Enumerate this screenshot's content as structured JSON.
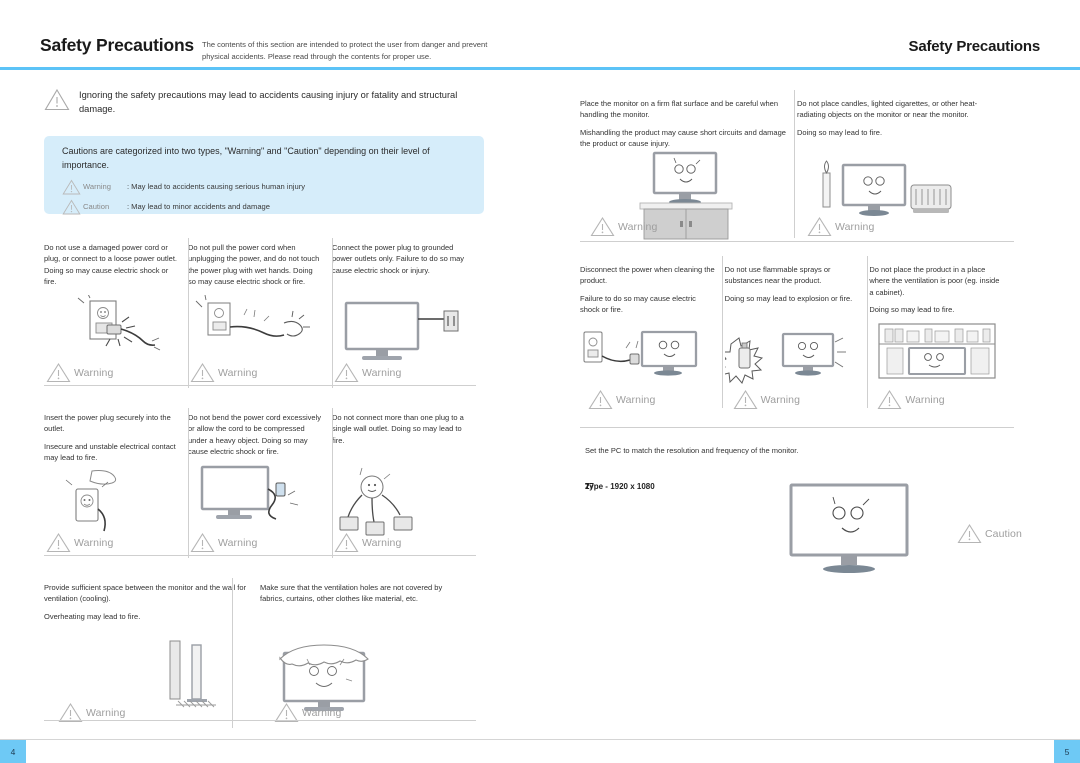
{
  "header": {
    "title_left": "Safety Precautions",
    "subtitle": "The contents of this section are intended to protect the user from danger and prevent physical accidents. Please read through the contents for proper use.",
    "title_right": "Safety Precautions"
  },
  "intro": {
    "icon": "warning-triangle-icon",
    "text": "Ignoring the safety precautions may lead to accidents causing injury or fatality and structural damage."
  },
  "notice": {
    "heading": "Cautions are categorized into two types, \"Warning\" and \"Caution\" depending on their level of importance.",
    "rows": [
      {
        "label": "Warning",
        "separator": ":",
        "desc": "May lead to accidents causing serious human injury"
      },
      {
        "label": "Caution",
        "separator": ":",
        "desc": "May lead to minor accidents and damage"
      }
    ]
  },
  "left_page": {
    "page_number": "4",
    "row1": [
      {
        "text": "Do not use a damaged power cord or plug, or connect to a loose power outlet. Doing so may cause electric shock or fire.",
        "badge": "Warning",
        "art": "outlet-damaged-plug"
      },
      {
        "text": "Do not pull the power cord when unplugging the power, and do not touch the power plug with wet hands. Doing so may cause electric shock or fire.",
        "badge": "Warning",
        "art": "wet-hand-plug"
      },
      {
        "text": "Connect the power plug to grounded power outlets only. Failure to do so may cause electric shock or injury.",
        "badge": "Warning",
        "art": "monitor-grounded"
      }
    ],
    "row2": [
      {
        "text_a": "Insert the power plug securely into the outlet.",
        "text_b": "Insecure and unstable electrical contact may lead to fire.",
        "badge": "Warning",
        "art": "plug-into-outlet"
      },
      {
        "text": "Do not bend the power cord excessively or allow the cord to be compressed under a heavy object. Doing so may cause electric shock or fire.",
        "badge": "Warning",
        "art": "monitor-cord-bend"
      },
      {
        "text": "Do not connect more than one plug to a single wall outlet. Doing so may lead to fire.",
        "badge": "Warning",
        "art": "multi-plug-overload"
      }
    ],
    "row3": [
      {
        "text_a": "Provide sufficient space between the monitor and the wall for ventilation (cooling).",
        "text_b": "Overheating may lead to fire.",
        "badge": "Warning",
        "art": "monitor-wall-gap"
      },
      {
        "text": "Make sure that the ventilation holes are not covered by fabrics, curtains, other clothes like material, etc.",
        "badge": "Warning",
        "art": "monitor-covered-cloth"
      }
    ]
  },
  "right_page": {
    "page_number": "5",
    "row1": [
      {
        "text_a": "Place the monitor on a firm flat surface and be careful when handling the monitor.",
        "text_b": "Mishandling the product may cause short circuits and damage the product or cause injury.",
        "badge": "Warning",
        "art": "monitor-on-cabinet"
      },
      {
        "text_a": "Do not place candles, lighted cigarettes, or other heat-radiating objects on the monitor or near the monitor.",
        "text_b": "Doing so may lead to fire.",
        "badge": "Warning",
        "art": "monitor-candle-heater"
      }
    ],
    "row2": [
      {
        "text_a": "Disconnect the power when cleaning the product.",
        "text_b": "Failure to do so may cause electric shock or fire.",
        "badge": "Warning",
        "art": "unplug-cleaning"
      },
      {
        "text_a": "Do not use flammable sprays or substances near the product.",
        "text_b": "Doing so may lead to explosion or fire.",
        "badge": "Warning",
        "art": "spray-explosion"
      },
      {
        "text_a": "Do not place the product in a place where the ventilation is poor (eg. inside a cabinet).",
        "text_b": "Doing so may lead to fire.",
        "badge": "Warning",
        "art": "monitor-in-cabinet"
      }
    ],
    "caution_block": {
      "text": "Set the PC to match the resolution and frequency of the monitor.",
      "spec_primary": "Type - 1920 x 1080",
      "spec_overlay": "27",
      "badge": "Caution",
      "art": "monitor-resolution"
    }
  },
  "colors": {
    "rule": "#5cc3f7",
    "notice_bg": "#d6edfa",
    "page_tab": "#6ec9f5",
    "badge_text": "#9e9e9e",
    "divider": "#cfcfcf"
  }
}
